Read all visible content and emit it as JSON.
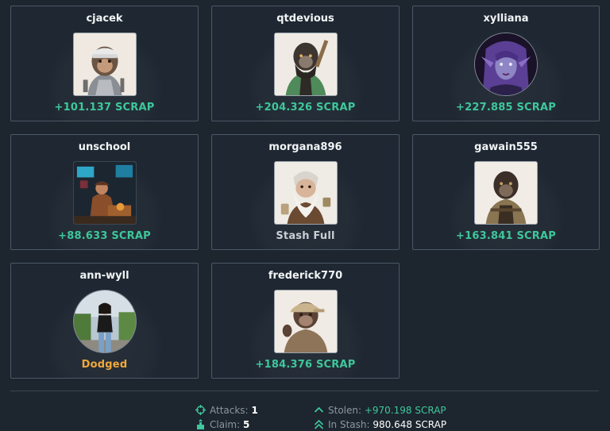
{
  "colors": {
    "background": "#1d252e",
    "card_border": "#4a5866",
    "green": "#3ec79b",
    "orange": "#f2a93a"
  },
  "cards": [
    {
      "username": "cjacek",
      "result": "+101.137 SCRAP",
      "result_type": "gain",
      "avatar": "ape-mechanic-avatar"
    },
    {
      "username": "qtdevious",
      "result": "+204.326 SCRAP",
      "result_type": "gain",
      "avatar": "ape-green-jacket-avatar"
    },
    {
      "username": "xylliana",
      "result": "+227.885 SCRAP",
      "result_type": "gain",
      "avatar": "purple-elf-avatar"
    },
    {
      "username": "unschool",
      "result": "+88.633 SCRAP",
      "result_type": "gain",
      "avatar": "neon-workshop-avatar"
    },
    {
      "username": "morgana896",
      "result": "Stash Full",
      "result_type": "neutral",
      "avatar": "bearded-gnome-avatar"
    },
    {
      "username": "gawain555",
      "result": "+163.841 SCRAP",
      "result_type": "gain",
      "avatar": "ape-tan-vest-avatar"
    },
    {
      "username": "ann-wyll",
      "result": "Dodged",
      "result_type": "dodged",
      "avatar": "woman-photo-avatar"
    },
    {
      "username": "frederick770",
      "result": "+184.376 SCRAP",
      "result_type": "gain",
      "avatar": "ape-cap-avatar"
    }
  ],
  "stats": {
    "attacks_label": "Attacks:",
    "attacks_value": "1",
    "claim_label": "Claim:",
    "claim_value": "5",
    "stolen_label": "Stolen:",
    "stolen_value": "+970.198 SCRAP",
    "stash_label": "In Stash:",
    "stash_value": "980.648 SCRAP"
  }
}
